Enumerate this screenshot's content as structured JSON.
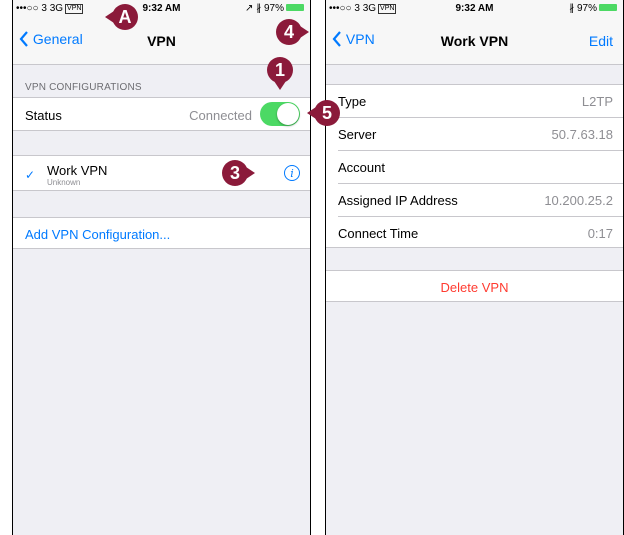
{
  "left_screen": {
    "status_bar": {
      "carrier": "•••○○ 3  3G",
      "vpn_badge": "VPN",
      "time": "9:32 AM",
      "right": "↗ ∦ 97%"
    },
    "nav": {
      "back_label": "General",
      "title": "VPN"
    },
    "section_header": "VPN CONFIGURATIONS",
    "status": {
      "label": "Status",
      "value": "Connected",
      "toggle_on": true
    },
    "vpn_item": {
      "name": "Work VPN",
      "subtitle": "Unknown",
      "info_icon": "info-icon"
    },
    "add_config_label": "Add VPN Configuration..."
  },
  "right_screen": {
    "status_bar": {
      "carrier": "•••○○ 3  3G",
      "vpn_badge": "VPN",
      "time": "9:32 AM",
      "right": "∦ 97%"
    },
    "nav": {
      "back_label": "VPN",
      "title": "Work VPN",
      "edit_label": "Edit"
    },
    "details": [
      {
        "label": "Type",
        "value": "L2TP"
      },
      {
        "label": "Server",
        "value": "50.7.63.18"
      },
      {
        "label": "Account",
        "value": ""
      },
      {
        "label": "Assigned IP Address",
        "value": "10.200.25.2"
      },
      {
        "label": "Connect Time",
        "value": "0:17"
      }
    ],
    "delete_label": "Delete VPN"
  },
  "callouts": {
    "a": "A",
    "c1": "1",
    "c3": "3",
    "c4": "4",
    "c5": "5"
  },
  "colors": {
    "accent": "#007aff",
    "toggle_on": "#4cd964",
    "destructive": "#ff3b30",
    "callout": "#8b1a3a"
  }
}
